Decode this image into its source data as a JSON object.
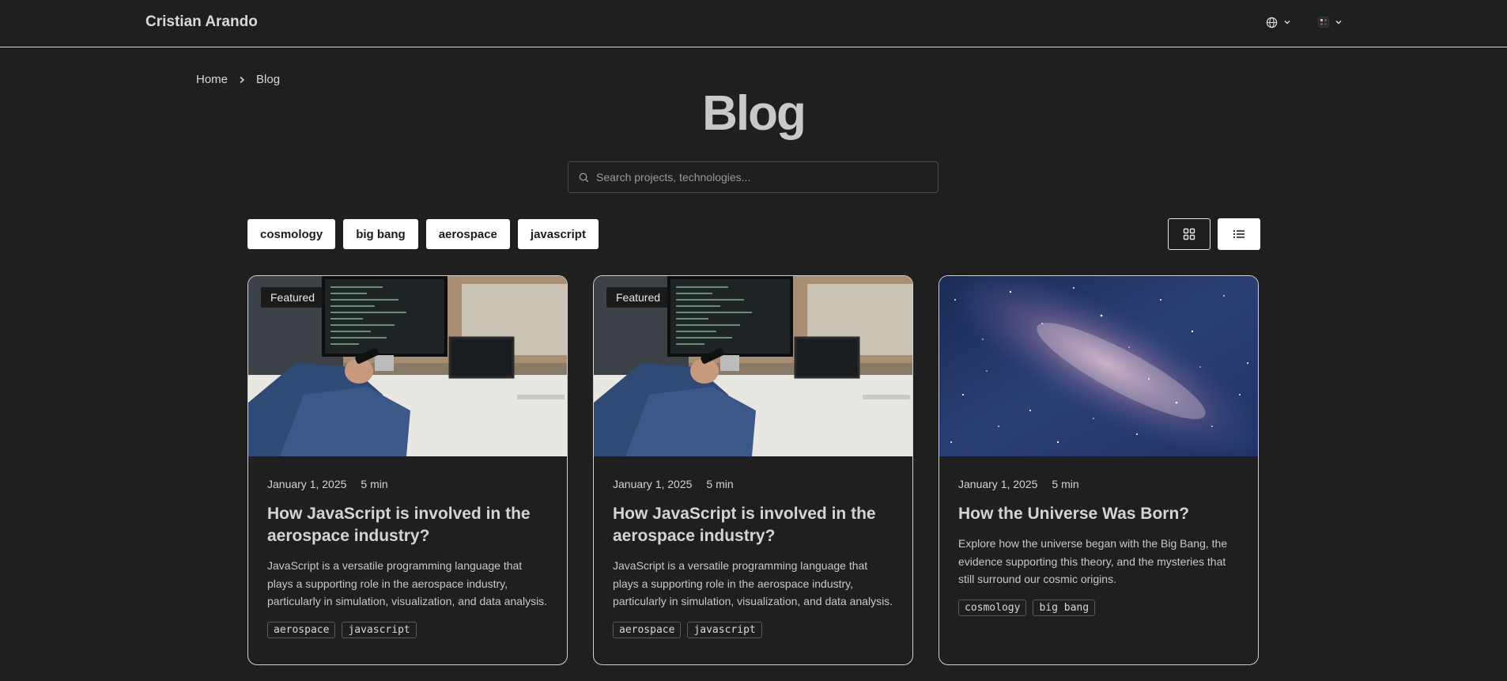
{
  "header": {
    "brand": "Cristian Arando",
    "language_icon": "globe-icon",
    "theme_icon": "palette-icon"
  },
  "breadcrumb": {
    "home": "Home",
    "current": "Blog"
  },
  "page": {
    "title": "Blog"
  },
  "search": {
    "placeholder": "Search projects, technologies..."
  },
  "filters": [
    "cosmology",
    "big bang",
    "aerospace",
    "javascript"
  ],
  "view": {
    "grid_icon": "grid-view-icon",
    "list_icon": "list-view-icon"
  },
  "posts": [
    {
      "badge": "Featured",
      "date": "January 1, 2025",
      "read_time": "5 min",
      "title": "How JavaScript is involved in the aerospace industry?",
      "description": "JavaScript is a versatile programming language that plays a supporting role in the aerospace industry, particularly in simulation, visualization, and data analysis.",
      "tags": [
        "aerospace",
        "javascript"
      ]
    },
    {
      "badge": "Featured",
      "date": "January 1, 2025",
      "read_time": "5 min",
      "title": "How JavaScript is involved in the aerospace industry?",
      "description": "JavaScript is a versatile programming language that plays a supporting role in the aerospace industry, particularly in simulation, visualization, and data analysis.",
      "tags": [
        "aerospace",
        "javascript"
      ]
    },
    {
      "badge": "",
      "date": "January 1, 2025",
      "read_time": "5 min",
      "title": "How the Universe Was Born?",
      "description": "Explore how the universe began with the Big Bang, the evidence supporting this theory, and the mysteries that still surround our cosmic origins.",
      "tags": [
        "cosmology",
        "big bang"
      ]
    }
  ],
  "colors": {
    "background": "#1f1f1f",
    "text": "#d4d4d4",
    "button_bg": "#ffffff",
    "border": "#d0d0d0"
  }
}
